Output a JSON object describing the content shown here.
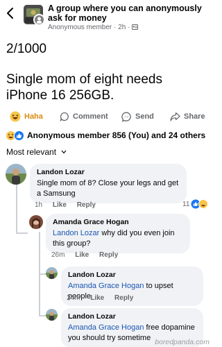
{
  "header": {
    "group_name": "A group where you can anonymously ask for money",
    "author": "Anonymous member",
    "time": "2h",
    "icons": [
      "back-chevron-icon",
      "group-avatar",
      "members-privacy-icon"
    ]
  },
  "post": {
    "count": "2/1000",
    "line1": "Single mom of eight needs",
    "line2": "iPhone 16 256GB."
  },
  "actions": {
    "haha": "Haha",
    "comment": "Comment",
    "send": "Send",
    "share": "Share"
  },
  "reactions": {
    "summary": "Anonymous member 856 (You) and 24 others",
    "types": [
      "haha",
      "like"
    ]
  },
  "comments_sort": "Most relevant",
  "comments": [
    {
      "author": "Landon Lozar",
      "text": "Single mom of 8? Close your legs and get a Samsung",
      "time": "1h",
      "like": "Like",
      "reply": "Reply",
      "reaction_count": "11"
    },
    {
      "author": "Amanda Grace Hogan",
      "mention": "Landon Lozar",
      "text": " why did you even join this group?",
      "time": "26m",
      "like": "Like",
      "reply": "Reply"
    },
    {
      "author": "Landon Lozar",
      "mention": "Amanda Grace Hogan",
      "text": " to upset people",
      "time": "24m",
      "like": "Like",
      "reply": "Reply"
    },
    {
      "author": "Landon Lozar",
      "mention": "Amanda Grace Hogan",
      "text": " free dopamine you should try sometime"
    }
  ],
  "watermark": "boredpanda.com",
  "colors": {
    "mention": "#1a55b3",
    "secondary_text": "#65676b",
    "bubble": "#f0f2f5",
    "haha": "#d98c10",
    "like": "#1877f2"
  }
}
